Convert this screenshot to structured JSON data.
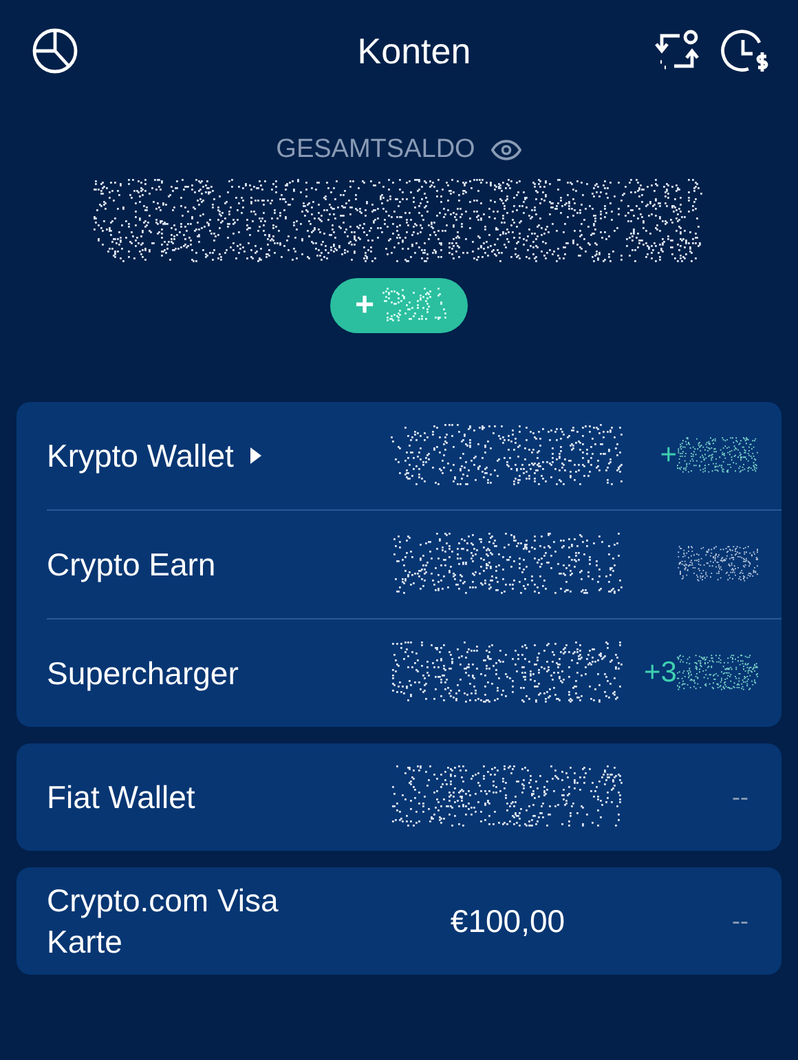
{
  "header": {
    "title": "Konten"
  },
  "total": {
    "label": "GESAMTSALDO",
    "hidden_balance": true,
    "change_prefix": "+"
  },
  "groups": [
    {
      "rows": [
        {
          "name": "Krypto Wallet",
          "expandable": true,
          "value": {
            "kind": "masked"
          },
          "change": {
            "kind": "masked",
            "prefix": "+"
          }
        },
        {
          "name": "Crypto Earn",
          "expandable": false,
          "value": {
            "kind": "masked"
          },
          "change": {
            "kind": "masked"
          }
        },
        {
          "name": "Supercharger",
          "expandable": false,
          "value": {
            "kind": "masked"
          },
          "change": {
            "kind": "masked",
            "prefix": "+3"
          }
        }
      ]
    },
    {
      "rows": [
        {
          "name": "Fiat Wallet",
          "expandable": false,
          "value": {
            "kind": "masked"
          },
          "change": {
            "kind": "text",
            "text": "--"
          }
        }
      ]
    },
    {
      "rows": [
        {
          "name": "Crypto.com Visa Karte",
          "expandable": false,
          "value": {
            "kind": "text",
            "text": "€100,00"
          },
          "change": {
            "kind": "text",
            "text": "--"
          }
        }
      ]
    }
  ]
}
